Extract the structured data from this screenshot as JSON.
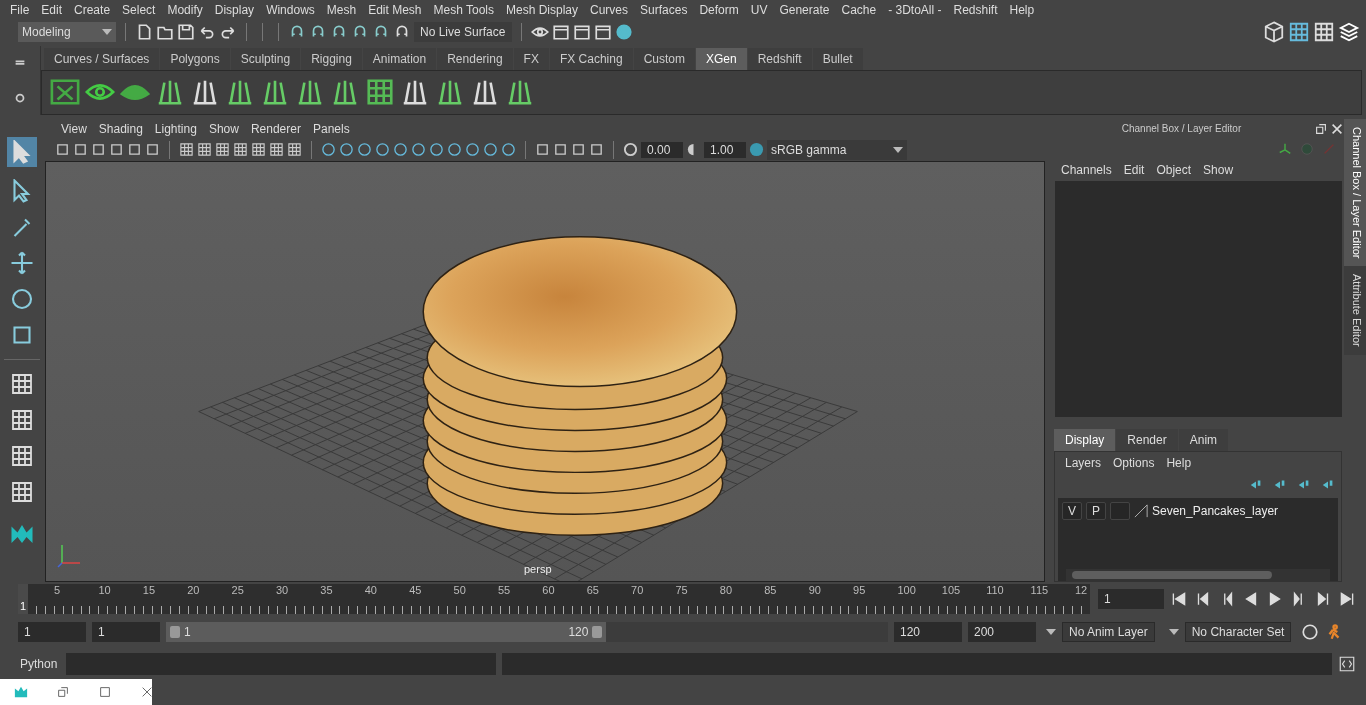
{
  "menubar": [
    "File",
    "Edit",
    "Create",
    "Select",
    "Modify",
    "Display",
    "Windows",
    "Mesh",
    "Edit Mesh",
    "Mesh Tools",
    "Mesh Display",
    "Curves",
    "Surfaces",
    "Deform",
    "UV",
    "Generate",
    "Cache",
    "- 3DtoAll -",
    "Redshift",
    "Help"
  ],
  "status_line": {
    "mode": "Modeling",
    "live_surface": "No Live Surface"
  },
  "shelf": {
    "tabs": [
      {
        "label": "Curves / Surfaces",
        "selected": false
      },
      {
        "label": "Polygons",
        "selected": false
      },
      {
        "label": "Sculpting",
        "selected": false
      },
      {
        "label": "Rigging",
        "selected": false
      },
      {
        "label": "Animation",
        "selected": false
      },
      {
        "label": "Rendering",
        "selected": false
      },
      {
        "label": "FX",
        "selected": false
      },
      {
        "label": "FX Caching",
        "selected": false
      },
      {
        "label": "Custom",
        "selected": false
      },
      {
        "label": "XGen",
        "selected": true
      },
      {
        "label": "Redshift",
        "selected": false
      },
      {
        "label": "Bullet",
        "selected": false
      }
    ]
  },
  "viewport": {
    "menus": [
      "View",
      "Shading",
      "Lighting",
      "Show",
      "Renderer",
      "Panels"
    ],
    "exposure": "0.00",
    "gamma": "1.00",
    "color_space": "sRGB gamma",
    "camera": "persp"
  },
  "channel_box": {
    "title": "Channel Box / Layer Editor",
    "menus": [
      "Channels",
      "Edit",
      "Object",
      "Show"
    ]
  },
  "side_tabs": [
    {
      "label": "Channel Box / Layer Editor",
      "selected": true
    },
    {
      "label": "Attribute Editor",
      "selected": false
    }
  ],
  "layer_editor": {
    "tabs": [
      {
        "label": "Display",
        "selected": true
      },
      {
        "label": "Render",
        "selected": false
      },
      {
        "label": "Anim",
        "selected": false
      }
    ],
    "menus": [
      "Layers",
      "Options",
      "Help"
    ],
    "layers": [
      {
        "visible": "V",
        "playback": "P",
        "name": "Seven_Pancakes_layer"
      }
    ]
  },
  "time_slider": {
    "current_frame": "1",
    "ticks": [
      "5",
      "10",
      "15",
      "20",
      "25",
      "30",
      "35",
      "40",
      "45",
      "50",
      "55",
      "60",
      "65",
      "70",
      "75",
      "80",
      "85",
      "90",
      "95",
      "100",
      "105",
      "110",
      "115",
      "12"
    ],
    "frame_field": "1"
  },
  "range_slider": {
    "start": "1",
    "playback_start": "1",
    "range_start": "1",
    "range_end": "120",
    "level": 0.61,
    "playback_end": "120",
    "end": "200",
    "anim_layer": "No Anim Layer",
    "character_set": "No Character Set"
  },
  "command_line": {
    "label": "Python"
  }
}
